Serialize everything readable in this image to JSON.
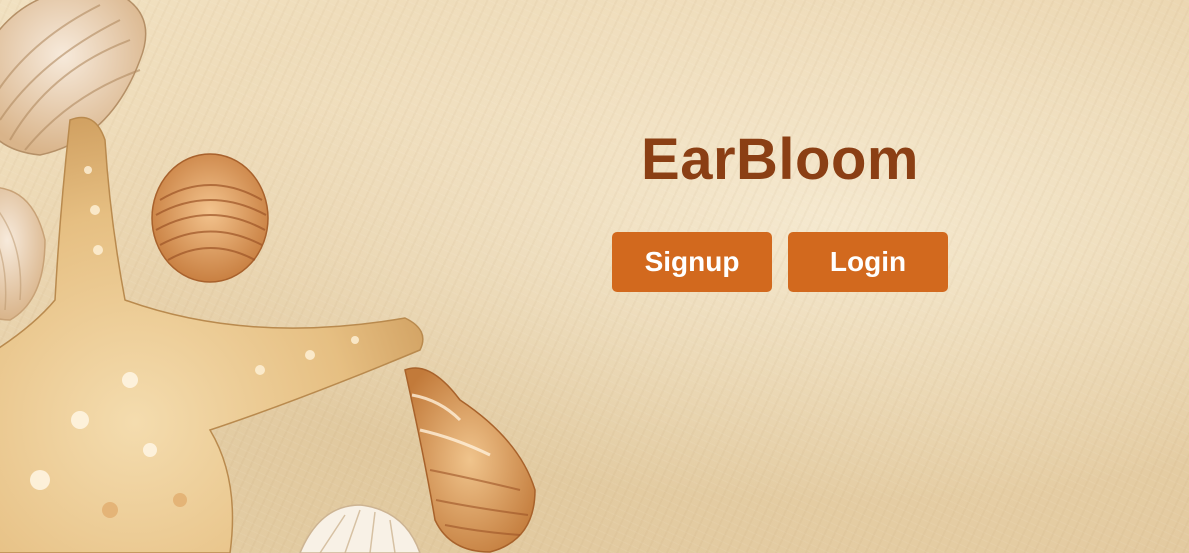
{
  "app": {
    "title": "EarBloom"
  },
  "actions": {
    "signup_label": "Signup",
    "login_label": "Login"
  },
  "colors": {
    "title": "#8b3f14",
    "button_bg": "#d2691e",
    "button_text": "#ffffff",
    "sand": "#ecd7b2"
  },
  "background": {
    "icons": [
      "starfish-icon",
      "seashell-icon",
      "conch-shell-icon"
    ]
  }
}
